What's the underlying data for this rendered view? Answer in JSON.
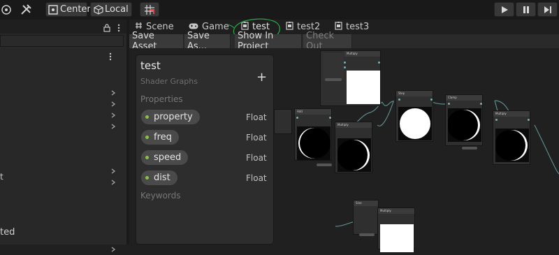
{
  "toolbar": {
    "pivot_label": "Center",
    "space_label": "Local"
  },
  "hierarchy": {
    "bottom_text": "ted",
    "left_partial": "t"
  },
  "tabs": [
    {
      "label": "Scene",
      "icon": "scene-hash-icon"
    },
    {
      "label": "Game",
      "icon": "gamepad-icon"
    },
    {
      "label": "test",
      "icon": "shader-graph-icon"
    },
    {
      "label": "test2",
      "icon": "shader-graph-icon"
    },
    {
      "label": "test3",
      "icon": "shader-graph-icon"
    }
  ],
  "graph_toolbar": {
    "save_asset": "Save Asset",
    "save_as": "Save As...",
    "show_in_project": "Show In Project",
    "check_out": "Check Out"
  },
  "blackboard": {
    "title": "test",
    "subtitle": "Shader Graphs",
    "add": "+",
    "properties_label": "Properties",
    "keywords_label": "Keywords",
    "properties": [
      {
        "name": "property",
        "type": "Float"
      },
      {
        "name": "freq",
        "type": "Float"
      },
      {
        "name": "speed",
        "type": "Float"
      },
      {
        "name": "dist",
        "type": "Float"
      }
    ]
  },
  "nodes": {
    "n1_title": "Multiply",
    "n2_title": "Add",
    "n3_title": "Multiply",
    "n4_title": "Step",
    "n5_title": "Clamp",
    "n6_title": "Multiply",
    "n7_title": "Sine",
    "n8_title": "Multiply",
    "n9_title": "Add"
  },
  "colors": {
    "accent_circle": "#27a844",
    "property_dot": "#8cc04a",
    "edge": "#5c8a8a"
  }
}
